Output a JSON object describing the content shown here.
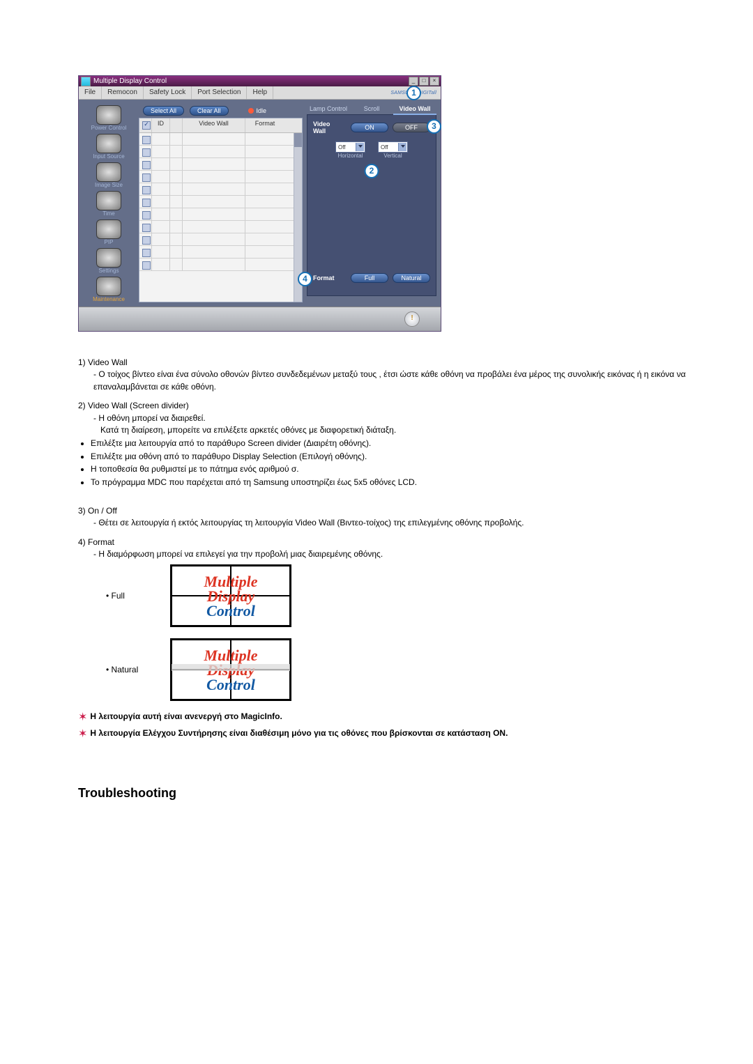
{
  "window": {
    "title": "Multiple Display Control",
    "menu": [
      "File",
      "Remocon",
      "Safety Lock",
      "Port Selection",
      "Help"
    ],
    "brand": "SAMSUNG DIGITall"
  },
  "sidebar": {
    "items": [
      {
        "label": "Power Control"
      },
      {
        "label": "Input Source"
      },
      {
        "label": "Image Size"
      },
      {
        "label": "Time"
      },
      {
        "label": "PIP"
      },
      {
        "label": "Settings"
      },
      {
        "label": "Maintenance"
      }
    ]
  },
  "center": {
    "select_all": "Select All",
    "clear_all": "Clear All",
    "idle": "Idle",
    "columns": {
      "id": "ID",
      "video_wall": "Video Wall",
      "format": "Format"
    },
    "rows": 11
  },
  "right": {
    "tabs": [
      "Lamp Control",
      "Scroll",
      "Video Wall"
    ],
    "active_tab": 2,
    "video_wall_label": "Video Wall",
    "on": "ON",
    "off": "OFF",
    "horizontal_label": "Horizontal",
    "vertical_label": "Vertical",
    "horizontal_value": "Off",
    "vertical_value": "Off",
    "format_label": "Format",
    "format_full": "Full",
    "format_natural": "Natural"
  },
  "callouts": {
    "c1": "1",
    "c2": "2",
    "c3": "3",
    "c4": "4"
  },
  "body": {
    "i1_head": "1)  Video Wall",
    "i1_a": "-  Ο τοίχος βίντεο είναι ένα σύνολο οθονών βίντεο συνδεδεμένων μεταξύ τους , έτσι ώστε κάθε οθόνη να προβάλει ένα μέρος της συνολικής εικόνας ή η εικόνα να επαναλαμβάνεται σε κάθε οθόνη.",
    "i2_head": "2)  Video Wall (Screen divider)",
    "i2_a": "-  Η οθόνη μπορεί να διαιρεθεί.",
    "i2_b": "Κατά τη διαίρεση, μπορείτε να επιλέξετε αρκετές οθόνες με διαφορετική διάταξη.",
    "i2_bul": [
      "Επιλέξτε μια λειτουργία από το παράθυρο Screen divider (Διαιρέτη οθόνης).",
      "Επιλέξτε μια οθόνη από το παράθυρο Display Selection (Επιλογή οθόνης).",
      "Η τοποθεσία θα ρυθμιστεί με το πάτημα ενός αριθμού σ.",
      "Το πρόγραμμα MDC που παρέχεται από τη Samsung υποστηρίζει έως 5x5 οθόνες LCD."
    ],
    "i3_head": "3)  On / Off",
    "i3_a": "-  Θέτει σε λειτουργία ή εκτός λειτουργίας τη λειτουργία Video Wall (Βιντεο-τοίχος) της επιλεγμένης οθόνης προβολής.",
    "i4_head": "4)  Format",
    "i4_a": "-  Η διαμόρφωση μπορεί να επιλεγεί για την προβολή μιας διαιρεμένης οθόνης.",
    "format_full": "Full",
    "format_natural": "Natural",
    "tile_l1": "Multiple",
    "tile_l2": "Display",
    "tile_l3": "Control",
    "note1": "Η λειτουργία αυτή είναι ανενεργή στο MagicInfo.",
    "note2": "Η λειτουργία Ελέγχου Συντήρησης είναι διαθέσιμη μόνο για τις οθόνες που βρίσκονται σε κατάσταση ON.",
    "troubleshooting": "Troubleshooting"
  }
}
